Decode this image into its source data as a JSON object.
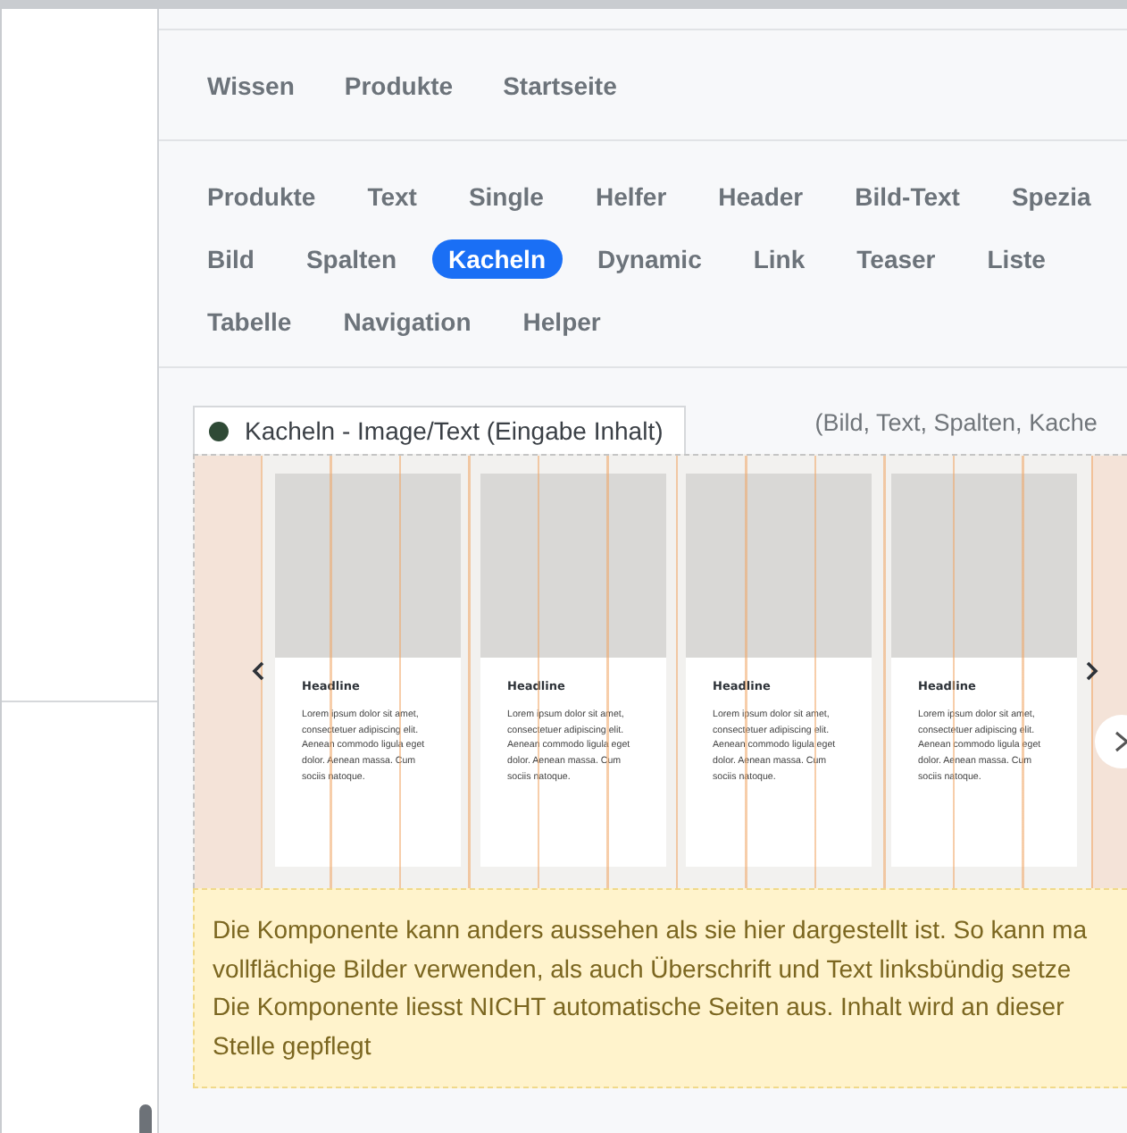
{
  "top_nav": [
    {
      "label": "Wissen",
      "selected": false
    },
    {
      "label": "Produkte",
      "selected": false
    },
    {
      "label": "Startseite",
      "selected": false
    }
  ],
  "categories": [
    [
      {
        "label": "Produkte",
        "selected": false
      },
      {
        "label": "Text",
        "selected": false
      },
      {
        "label": "Single",
        "selected": false
      },
      {
        "label": "Helfer",
        "selected": false
      },
      {
        "label": "Header",
        "selected": false
      },
      {
        "label": "Bild-Text",
        "selected": false
      },
      {
        "label": "Spezia",
        "selected": false
      }
    ],
    [
      {
        "label": "Bild",
        "selected": false
      },
      {
        "label": "Spalten",
        "selected": false
      },
      {
        "label": "Kacheln",
        "selected": true
      },
      {
        "label": "Dynamic",
        "selected": false
      },
      {
        "label": "Link",
        "selected": false
      },
      {
        "label": "Teaser",
        "selected": false
      },
      {
        "label": "Liste",
        "selected": false
      }
    ],
    [
      {
        "label": "Tabelle",
        "selected": false
      },
      {
        "label": "Navigation",
        "selected": false
      },
      {
        "label": "Helper",
        "selected": false
      }
    ]
  ],
  "component": {
    "title": "Kacheln - Image/Text (Eingabe Inhalt)",
    "hint": "(Bild, Text, Spalten, Kache"
  },
  "tiles": [
    {
      "headline": "Headline",
      "text": "Lorem ipsum dolor sit amet, consectetuer adipiscing elit. Aenean commodo ligula eget dolor. Aenean massa. Cum sociis natoque."
    },
    {
      "headline": "Headline",
      "text": "Lorem ipsum dolor sit amet, consectetuer adipiscing elit. Aenean commodo ligula eget dolor. Aenean massa. Cum sociis natoque."
    },
    {
      "headline": "Headline",
      "text": "Lorem ipsum dolor sit amet, consectetuer adipiscing elit. Aenean commodo ligula eget dolor. Aenean massa. Cum sociis natoque."
    },
    {
      "headline": "Headline",
      "text": "Lorem ipsum dolor sit amet, consectetuer adipiscing elit. Aenean commodo ligula eget dolor. Aenean massa. Cum sociis natoque."
    }
  ],
  "notice": {
    "lines": [
      "Die Komponente kann anders aussehen als sie hier dargestellt ist. So kann ma",
      "vollflächige Bilder verwenden, als auch Überschrift und Text linksbündig setze",
      "Die Komponente liesst NICHT automatische Seiten aus. Inhalt wird an dieser",
      "Stelle gepflegt"
    ]
  }
}
